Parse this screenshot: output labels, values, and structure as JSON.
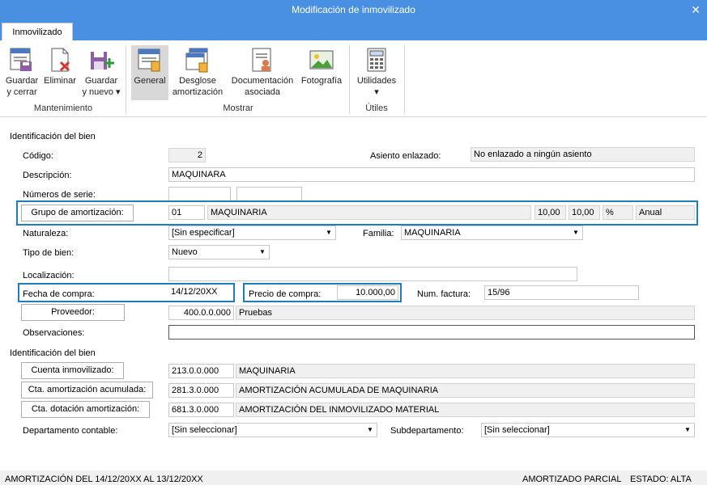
{
  "window": {
    "title": "Modificación de inmovilizado",
    "close_glyph": "✕"
  },
  "tabs": [
    {
      "label": "Inmovilizado"
    }
  ],
  "ribbon": {
    "groups": {
      "mantenimiento": "Mantenimiento",
      "mostrar": "Mostrar",
      "utiles": "Útiles"
    },
    "buttons": {
      "guardar_cerrar": [
        "Guardar",
        "y cerrar"
      ],
      "eliminar": [
        "Eliminar"
      ],
      "guardar_nuevo": [
        "Guardar",
        "y nuevo ▾"
      ],
      "general": [
        "General"
      ],
      "desglose": [
        "Desglose",
        "amortización"
      ],
      "documentacion": [
        "Documentación",
        "asociada"
      ],
      "fotografia": [
        "Fotografía"
      ],
      "utilidades": [
        "Utilidades",
        "▾"
      ]
    }
  },
  "section1": {
    "title": "Identificación del bien",
    "codigo_label": "Código:",
    "codigo_value": "2",
    "asiento_label": "Asiento enlazado:",
    "asiento_value": "No enlazado a ningún asiento",
    "descripcion_label": "Descripción:",
    "descripcion_value": "MAQUINARA",
    "numeros_serie_label": "Números de serie:",
    "grupo_button": "Grupo de amortización:",
    "grupo_code": "01",
    "grupo_name": "MAQUINARIA",
    "grupo_pct1": "10,00",
    "grupo_pct2": "10,00",
    "grupo_pct_symbol": "%",
    "grupo_periodo": "Anual",
    "naturaleza_label": "Naturaleza:",
    "naturaleza_value": "[Sin especificar]",
    "familia_label": "Familia:",
    "familia_value": "MAQUINARIA",
    "tipo_label": "Tipo de bien:",
    "tipo_value": "Nuevo",
    "localizacion_label": "Localización:",
    "localizacion_value": "",
    "fecha_label": "Fecha de compra:",
    "fecha_value": "14/12/20XX",
    "precio_label": "Precio de compra:",
    "precio_value": "10.000,00",
    "factura_label": "Num. factura:",
    "factura_value": "15/96",
    "proveedor_button": "Proveedor:",
    "proveedor_code": "400.0.0.000",
    "proveedor_name": "Pruebas",
    "observaciones_label": "Observaciones:",
    "observaciones_value": ""
  },
  "section2": {
    "title": "Identificación del bien",
    "cuenta_inmov_button": "Cuenta inmovilizado:",
    "cuenta_inmov_code": "213.0.0.000",
    "cuenta_inmov_name": "MAQUINARIA",
    "cta_amort_acum_button": "Cta. amortización acumulada:",
    "cta_amort_acum_code": "281.3.0.000",
    "cta_amort_acum_name": "AMORTIZACIÓN ACUMULADA DE MAQUINARIA",
    "cta_dot_button": "Cta. dotación amortización:",
    "cta_dot_code": "681.3.0.000",
    "cta_dot_name": "AMORTIZACIÓN DEL INMOVILIZADO MATERIAL",
    "departamento_label": "Departamento contable:",
    "departamento_value": "[Sin seleccionar]",
    "subdepartamento_label": "Subdepartamento:",
    "subdepartamento_value": "[Sin seleccionar]"
  },
  "status": {
    "left": "AMORTIZACIÓN DEL 14/12/20XX AL 13/12/20XX",
    "middle": "AMORTIZADO PARCIAL",
    "right": "ESTADO: ALTA"
  },
  "colors": {
    "titlebar": "#4a90e2",
    "highlight": "#1d7dbd"
  }
}
